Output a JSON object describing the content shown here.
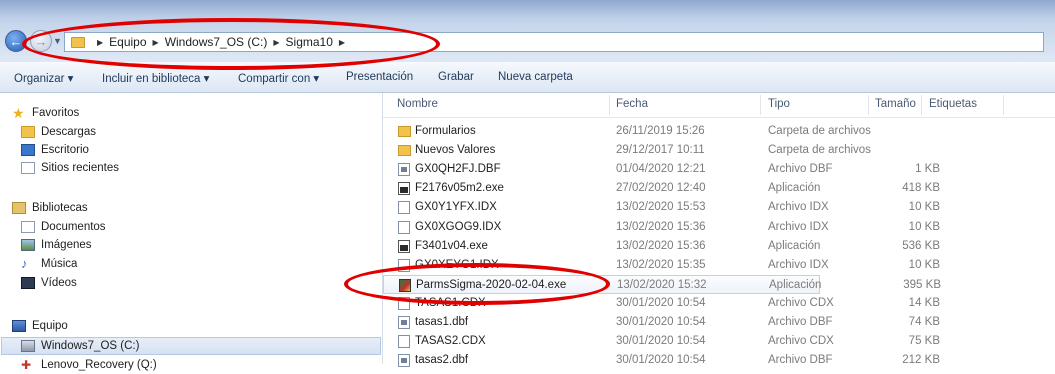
{
  "address": {
    "crumbs": [
      "Equipo",
      "Windows7_OS (C:)",
      "Sigma10"
    ]
  },
  "toolbar": {
    "organize": "Organizar ▾",
    "include": "Incluir en biblioteca ▾",
    "share": "Compartir con ▾",
    "presentation": "Presentación",
    "burn": "Grabar",
    "new_folder": "Nueva carpeta"
  },
  "nav": {
    "favorites": "Favoritos",
    "downloads": "Descargas",
    "desktop": "Escritorio",
    "recent": "Sitios recientes",
    "libraries": "Bibliotecas",
    "documents": "Documentos",
    "images": "Imágenes",
    "music": "Música",
    "videos": "Vídeos",
    "computer": "Equipo",
    "drive_c": "Windows7_OS (C:)",
    "drive_q": "Lenovo_Recovery (Q:)"
  },
  "columns": {
    "name": "Nombre",
    "date": "Fecha",
    "type": "Tipo",
    "size": "Tamaño",
    "tags": "Etiquetas"
  },
  "files": [
    {
      "name": "Formularios",
      "date": "26/11/2019 15:26",
      "type": "Carpeta de archivos",
      "size": "",
      "icon": "folder-icon"
    },
    {
      "name": "Nuevos Valores",
      "date": "29/12/2017 10:11",
      "type": "Carpeta de archivos",
      "size": "",
      "icon": "folder-icon"
    },
    {
      "name": "GX0QH2FJ.DBF",
      "date": "01/04/2020 12:21",
      "type": "Archivo DBF",
      "size": "1 KB",
      "icon": "dbf-file-icon"
    },
    {
      "name": "F2176v05m2.exe",
      "date": "27/02/2020 12:40",
      "type": "Aplicación",
      "size": "418 KB",
      "icon": "app-icon"
    },
    {
      "name": "GX0Y1YFX.IDX",
      "date": "13/02/2020 15:53",
      "type": "Archivo IDX",
      "size": "10 KB",
      "icon": "blank-file-icon"
    },
    {
      "name": "GX0XGOG9.IDX",
      "date": "13/02/2020 15:36",
      "type": "Archivo IDX",
      "size": "10 KB",
      "icon": "blank-file-icon"
    },
    {
      "name": "F3401v04.exe",
      "date": "13/02/2020 15:36",
      "type": "Aplicación",
      "size": "536 KB",
      "icon": "app-icon"
    },
    {
      "name": "GX0XEYG1.IDX",
      "date": "13/02/2020 15:35",
      "type": "Archivo IDX",
      "size": "10 KB",
      "icon": "blank-file-icon"
    },
    {
      "name": "ParmsSigma-2020-02-04.exe",
      "date": "13/02/2020 15:32",
      "type": "Aplicación",
      "size": "395 KB",
      "icon": "parms-app-icon",
      "selected": true
    },
    {
      "name": "TASAS1.CDX",
      "date": "30/01/2020 10:54",
      "type": "Archivo CDX",
      "size": "14 KB",
      "icon": "blank-file-icon"
    },
    {
      "name": "tasas1.dbf",
      "date": "30/01/2020 10:54",
      "type": "Archivo DBF",
      "size": "74 KB",
      "icon": "dbf-file-icon"
    },
    {
      "name": "TASAS2.CDX",
      "date": "30/01/2020 10:54",
      "type": "Archivo CDX",
      "size": "75 KB",
      "icon": "blank-file-icon"
    },
    {
      "name": "tasas2.dbf",
      "date": "30/01/2020 10:54",
      "type": "Archivo DBF",
      "size": "212 KB",
      "icon": "dbf-file-icon"
    }
  ],
  "colors": {
    "annotation": "#e00000",
    "selection_border": "#c7cfdb"
  }
}
